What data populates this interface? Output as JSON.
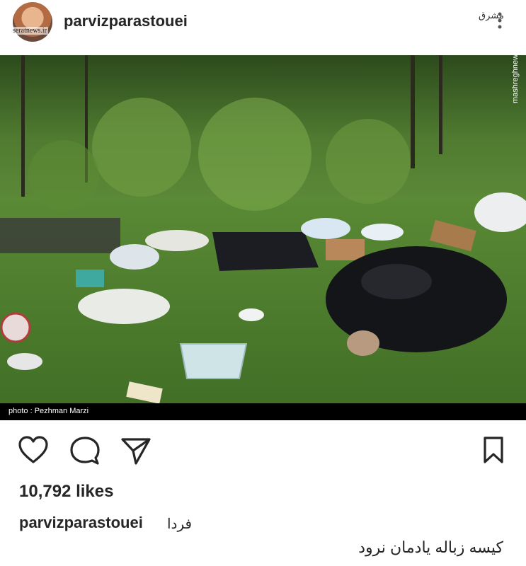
{
  "post": {
    "username": "parvizparastouei",
    "avatar_watermark": "seratnews.ir",
    "site_watermark_top": "مشرق",
    "site_watermark_side": "mashreghnews.ir",
    "photo_credit": "photo : Pezhman Marzi",
    "likes": "10,792 likes",
    "caption_username": "parvizparastouei",
    "caption_word": "فردا",
    "caption_line2": "کیسه زباله یادمان نرود"
  },
  "icons": {
    "like": "heart-icon",
    "comment": "comment-icon",
    "share": "send-icon",
    "save": "bookmark-icon",
    "more": "more-icon"
  }
}
